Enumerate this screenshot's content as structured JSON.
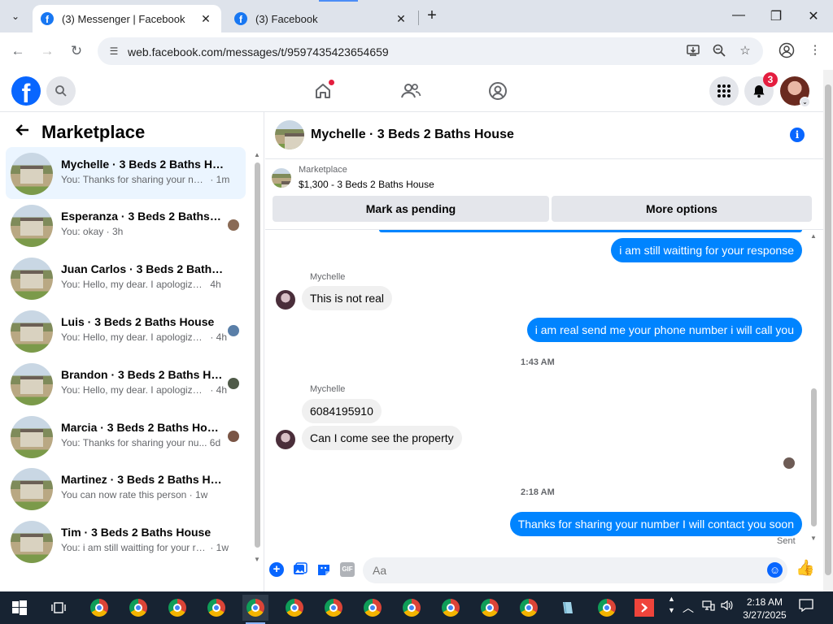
{
  "browser": {
    "tabs": [
      {
        "title": "(3) Messenger | Facebook",
        "active": true
      },
      {
        "title": "(3) Facebook",
        "active": false
      }
    ],
    "url": "web.facebook.com/messages/t/9597435423654659",
    "new_tab": "+",
    "minimize": "—",
    "maximize": "❐",
    "close": "✕"
  },
  "facebook": {
    "notification_count": "3"
  },
  "left_panel": {
    "title": "Marketplace",
    "conversations": [
      {
        "name": "Mychelle · 3 Beds 2 Baths House",
        "snippet": "You: Thanks for sharing your num...",
        "time": "· 1m",
        "selected": true
      },
      {
        "name": "Esperanza · 3 Beds 2 Baths Ho...",
        "snippet": "You: okay",
        "time": "· 3h"
      },
      {
        "name": "Juan Carlos · 3 Beds 2 Baths Ho...",
        "snippet": "You: Hello, my dear. I apologize for ...",
        "time": "4h"
      },
      {
        "name": "Luis · 3 Beds 2 Baths House",
        "snippet": "You: Hello, my dear. I apologize ...",
        "time": "· 4h"
      },
      {
        "name": "Brandon · 3 Beds 2 Baths Hou...",
        "snippet": "You: Hello, my dear. I apologize ...",
        "time": "· 4h"
      },
      {
        "name": "Marcia · 3 Beds 2 Baths House",
        "snippet": "You: Thanks for sharing your nu...",
        "time": "6d"
      },
      {
        "name": "Martinez · 3 Beds 2 Baths House",
        "snippet": "You can now rate this person",
        "time": "· 1w"
      },
      {
        "name": "Tim · 3 Beds 2 Baths House",
        "snippet": "You: i am still waitting for your res...",
        "time": "· 1w"
      }
    ]
  },
  "conversation": {
    "title": "Mychelle · 3 Beds 2 Baths House",
    "marketplace_label": "Marketplace",
    "listing": "$1,300 - 3 Beds 2 Baths House",
    "mark_pending": "Mark as pending",
    "more_options": "More options",
    "messages": {
      "out1": "i am still waitting for your response",
      "sender1": "Mychelle",
      "in1": "This is not real",
      "out2": "i  am real send me your phone number i will call you",
      "time1": "1:43 AM",
      "sender2": "Mychelle",
      "in2": "6084195910",
      "in3": "Can I come see the property",
      "time2": "2:18 AM",
      "out3": "Thanks for sharing your number I will contact you soon",
      "status": "Sent"
    },
    "composer_placeholder": "Aa"
  },
  "taskbar": {
    "time": "2:18 AM",
    "date": "3/27/2025"
  },
  "colors": {
    "brand": "#0866ff",
    "outgoing_bubble": "#0084ff",
    "incoming_bubble": "#f0f0f0",
    "badge": "#e41e3f"
  }
}
